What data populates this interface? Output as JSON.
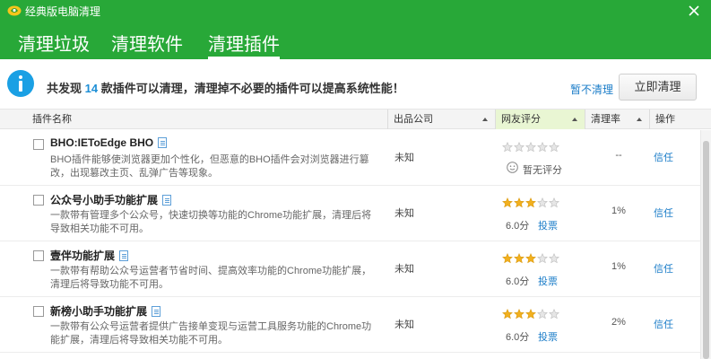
{
  "app": {
    "title": "经典版电脑清理"
  },
  "tabs": [
    {
      "label": "清理垃圾",
      "active": false
    },
    {
      "label": "清理软件",
      "active": false
    },
    {
      "label": "清理插件",
      "active": true
    }
  ],
  "info": {
    "prefix": "共发现",
    "count": "14",
    "suffix": "款插件可以清理，清理掉不必要的插件可以提高系统性能！",
    "skip_label": "暂不清理",
    "clean_label": "立即清理"
  },
  "columns": {
    "name": "插件名称",
    "publisher": "出品公司",
    "rating": "网友评分",
    "clean_rate": "清理率",
    "action": "操作"
  },
  "rows": [
    {
      "name": "BHO:IEToEdge BHO",
      "desc": "BHO插件能够使浏览器更加个性化，但恶意的BHO插件会对浏览器进行篡改，出现篡改主页、乱弹广告等现象。",
      "publisher": "未知",
      "stars": 0,
      "score": "",
      "no_rating": "暂无评分",
      "vote": "",
      "clean_rate": "--",
      "action": "信任"
    },
    {
      "name": "公众号小助手功能扩展",
      "desc": "一款带有管理多个公众号，快速切换等功能的Chrome功能扩展，清理后将导致相关功能不可用。",
      "publisher": "未知",
      "stars": 3,
      "score": "6.0分",
      "no_rating": "",
      "vote": "投票",
      "clean_rate": "1%",
      "action": "信任"
    },
    {
      "name": "壹伴功能扩展",
      "desc": "一款带有帮助公众号运营者节省时间、提高效率功能的Chrome功能扩展，清理后将导致功能不可用。",
      "publisher": "未知",
      "stars": 3,
      "score": "6.0分",
      "no_rating": "",
      "vote": "投票",
      "clean_rate": "1%",
      "action": "信任"
    },
    {
      "name": "新榜小助手功能扩展",
      "desc": "一款带有公众号运营者提供广告接单变现与运营工具服务功能的Chrome功能扩展，清理后将导致相关功能不可用。",
      "publisher": "未知",
      "stars": 3,
      "score": "6.0分",
      "no_rating": "",
      "vote": "投票",
      "clean_rate": "2%",
      "action": "信任"
    }
  ],
  "colors": {
    "header_green": "#28a838",
    "info_blue": "#1aa0e4",
    "link_blue": "#1a7cc8",
    "star_gold": "#f2b01e",
    "star_empty": "#e6e6e6",
    "rating_col_bg": "#e9f6d3"
  },
  "icons": {
    "logo": "leaf-logo-icon",
    "close": "close-icon",
    "info": "info-icon",
    "doc": "document-icon",
    "smile": "smile-icon",
    "sort": "sort-up-icon"
  }
}
